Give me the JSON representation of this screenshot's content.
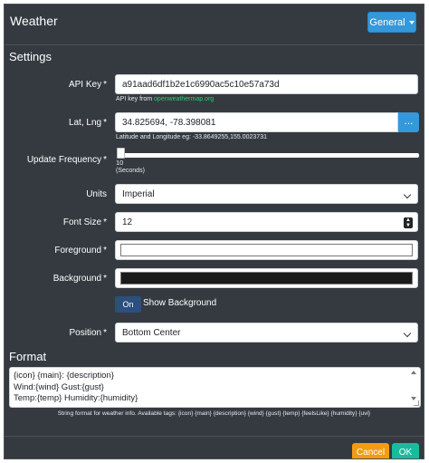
{
  "header": {
    "title": "Weather",
    "general_button": "General"
  },
  "settings": {
    "title": "Settings",
    "api_key": {
      "label": "API Key",
      "value": "a91aad6df1b2e1c6990ac5c10e57a73d",
      "help_prefix": "API key from",
      "help_link": "openweathermap.org"
    },
    "latlng": {
      "label": "Lat, Lng",
      "value": "34.825694, -78.398081",
      "button": "...",
      "help": "Latitude and Longitude eg: -33.8649255,155.0023731"
    },
    "update_frequency": {
      "label": "Update Frequency",
      "value": "10",
      "unit": "(Seconds)"
    },
    "units": {
      "label": "Units",
      "selected": "Imperial"
    },
    "font_size": {
      "label": "Font Size",
      "value": "12"
    },
    "foreground": {
      "label": "Foreground",
      "color": "#ffffff"
    },
    "background": {
      "label": "Background",
      "color": "#1a1a1a"
    },
    "show_background": {
      "toggle": "On",
      "label": "Show Background"
    },
    "position": {
      "label": "Position",
      "selected": "Bottom Center"
    }
  },
  "format": {
    "title": "Format",
    "lines": [
      "{icon} {main}: {description}",
      "Wind:{wind} Gust:{gust}",
      "Temp:{temp} Humidity:{humidity}"
    ],
    "help": "String format for weather info. Available tags: {icon} {main} {description} {wind} {gust} {temp} {feelsLike} {humidity} {uvi}"
  },
  "footer": {
    "cancel": "Cancel",
    "ok": "OK"
  },
  "required_marker": "*"
}
